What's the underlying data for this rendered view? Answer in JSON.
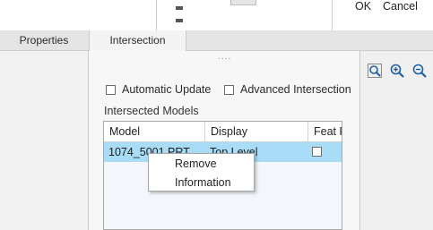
{
  "header": {
    "ok_label": "OK",
    "cancel_label": "Cancel"
  },
  "tabs": [
    {
      "label": "Properties",
      "active": false
    },
    {
      "label": "Intersection",
      "active": true
    }
  ],
  "panel": {
    "grip": "....",
    "options": [
      {
        "label": "Automatic Update",
        "checked": false
      },
      {
        "label": "Advanced Intersection",
        "checked": false
      }
    ],
    "section_label": "Intersected Models",
    "table": {
      "columns": [
        "Model",
        "Display",
        "Feat P"
      ],
      "rows": [
        {
          "model": "1074_5001.PRT",
          "display": "Top Level",
          "feat": false,
          "selected": true
        }
      ]
    }
  },
  "context_menu": {
    "items": [
      "Remove",
      "Information"
    ]
  },
  "view_tools": [
    "zoom-fit-icon",
    "zoom-in-icon",
    "zoom-out-icon"
  ],
  "colors": {
    "selection": "#a9dcf7",
    "icon_blue": "#1f5fa8"
  }
}
